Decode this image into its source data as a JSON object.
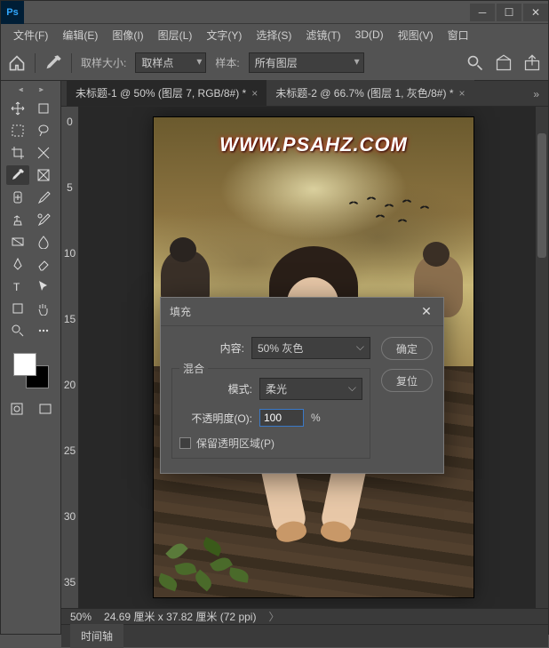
{
  "app": {
    "logo": "Ps"
  },
  "menus": [
    "文件(F)",
    "编辑(E)",
    "图像(I)",
    "图层(L)",
    "文字(Y)",
    "选择(S)",
    "滤镜(T)",
    "3D(D)",
    "视图(V)",
    "窗口"
  ],
  "options": {
    "sample_size_label": "取样大小:",
    "sample_size_value": "取样点",
    "sample_label": "样本:",
    "sample_value": "所有图层"
  },
  "tabs": [
    {
      "label": "未标题-1 @ 50% (图层 7, RGB/8#) *",
      "active": true
    },
    {
      "label": "未标题-2 @ 66.7% (图层 1, 灰色/8#) *",
      "active": false
    }
  ],
  "ruler_h": [
    "0",
    "5",
    "10",
    "15",
    "20"
  ],
  "ruler_v": [
    "0",
    "5",
    "10",
    "15",
    "20",
    "25",
    "30",
    "35"
  ],
  "canvas": {
    "watermark": "WWW.PSAHZ.COM"
  },
  "status": {
    "zoom": "50%",
    "dims": "24.69 厘米 x 37.82 厘米 (72 ppi)",
    "caret": "〉"
  },
  "panel": {
    "tab": "时间轴"
  },
  "dialog": {
    "title": "填充",
    "content_label": "内容:",
    "content_value": "50% 灰色",
    "blend_group": "混合",
    "mode_label": "模式:",
    "mode_value": "柔光",
    "opacity_label": "不透明度(O):",
    "opacity_value": "100",
    "opacity_unit": "%",
    "preserve": "保留透明区域(P)",
    "ok": "确定",
    "reset": "复位"
  },
  "chart_data": null
}
